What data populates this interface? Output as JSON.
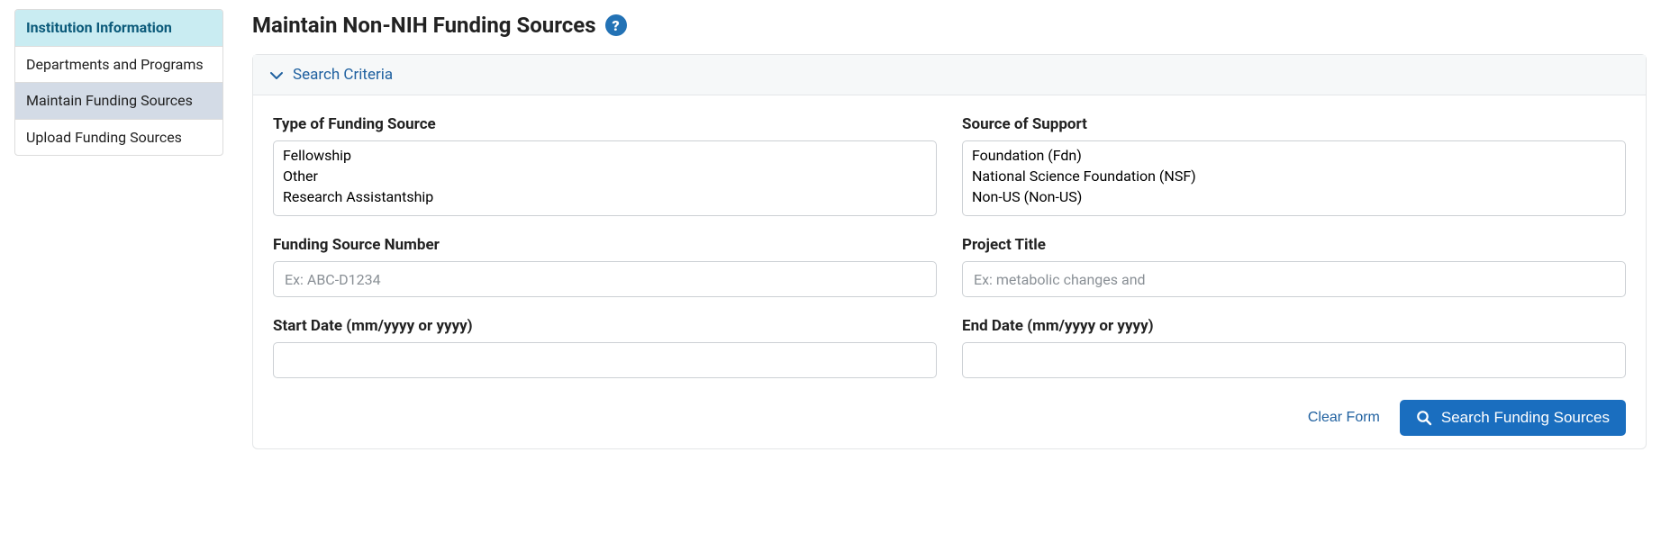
{
  "sidebar": {
    "header": "Institution Information",
    "items": [
      {
        "label": "Departments and Programs"
      },
      {
        "label": "Maintain Funding Sources"
      },
      {
        "label": "Upload Funding Sources"
      }
    ]
  },
  "page": {
    "title": "Maintain Non-NIH Funding Sources"
  },
  "panel": {
    "title": "Search Criteria"
  },
  "fields": {
    "type_label": "Type of Funding Source",
    "type_options": [
      "Fellowship",
      "Other",
      "Research Assistantship"
    ],
    "source_label": "Source of Support",
    "source_options": [
      "Foundation (Fdn)",
      "National Science Foundation (NSF)",
      "Non-US (Non-US)"
    ],
    "number_label": "Funding Source Number",
    "number_placeholder": "Ex: ABC-D1234",
    "title_label": "Project Title",
    "title_placeholder": "Ex: metabolic changes and",
    "start_label": "Start Date (mm/yyyy or yyyy)",
    "end_label": "End Date (mm/yyyy or yyyy)"
  },
  "actions": {
    "clear": "Clear Form",
    "search": "Search Funding Sources"
  }
}
